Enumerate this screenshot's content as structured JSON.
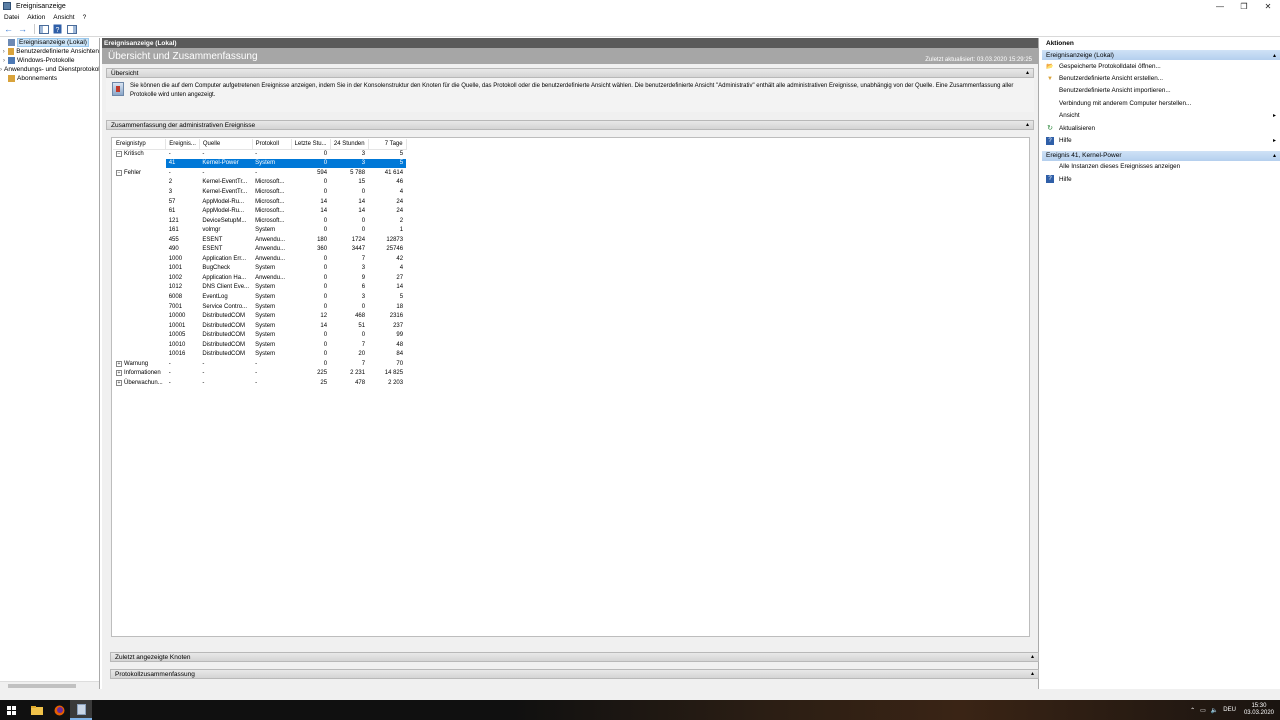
{
  "window": {
    "title": "Ereignisanzeige",
    "controls": [
      "—",
      "❐",
      "✕"
    ]
  },
  "menu": [
    "Datei",
    "Aktion",
    "Ansicht",
    "?"
  ],
  "tree": {
    "items": [
      {
        "label": "Ereignisanzeige (Lokal)",
        "expander": "",
        "selected": true,
        "color": "#6c89b3"
      },
      {
        "label": "Benutzerdefinierte Ansichten",
        "expander": "›",
        "color": "#d9a33b"
      },
      {
        "label": "Windows-Protokolle",
        "expander": "›",
        "color": "#4c79b5"
      },
      {
        "label": "Anwendungs- und Dienstprotokolle",
        "expander": "›",
        "color": "#d9a33b"
      },
      {
        "label": "Abonnements",
        "expander": "",
        "color": "#d9a33b"
      }
    ]
  },
  "center": {
    "header": "Ereignisanzeige (Lokal)",
    "title": "Übersicht und Zusammenfassung",
    "updated": "Zuletzt aktualisiert: 03.03.2020 15:29:25",
    "overview_label": "Übersicht",
    "overview_text": "Sie können die auf dem Computer aufgetretenen Ereignisse anzeigen, indem Sie in der Konsolenstruktur den Knoten für die Quelle, das Protokoll oder die benutzerdefinierte Ansicht wählen. Die benutzerdefinierte Ansicht \"Administrativ\" enthält alle administrativen Ereignisse, unabhängig von der Quelle. Eine Zusammenfassung aller Protokolle wird unten angezeigt.",
    "summary_label": "Zusammenfassung der administrativen Ereignisse",
    "recent_label": "Zuletzt angezeigte Knoten",
    "log_summary_label": "Protokollzusammenfassung",
    "collapse_glyph": "▴"
  },
  "table": {
    "headers": [
      "Ereignistyp",
      "Ereignis...",
      "Quelle",
      "Protokoll",
      "Letzte Stu...",
      "24 Stunden",
      "7 Tage"
    ],
    "rows": [
      {
        "group": true,
        "box": "−",
        "type": "Kritisch",
        "id": "-",
        "source": "-",
        "log": "-",
        "h": "0",
        "d": "3",
        "w": "5"
      },
      {
        "group": false,
        "selected": true,
        "type": "",
        "id": "41",
        "source": "Kernel-Power",
        "log": "System",
        "h": "0",
        "d": "3",
        "w": "5"
      },
      {
        "group": true,
        "box": "−",
        "type": "Fehler",
        "id": "-",
        "source": "-",
        "log": "-",
        "h": "594",
        "d": "5 788",
        "w": "41 614"
      },
      {
        "type": "",
        "id": "2",
        "source": "Kernel-EventTr...",
        "log": "Microsoft...",
        "h": "0",
        "d": "15",
        "w": "46"
      },
      {
        "type": "",
        "id": "3",
        "source": "Kernel-EventTr...",
        "log": "Microsoft...",
        "h": "0",
        "d": "0",
        "w": "4"
      },
      {
        "type": "",
        "id": "57",
        "source": "AppModel-Ru...",
        "log": "Microsoft...",
        "h": "14",
        "d": "14",
        "w": "24"
      },
      {
        "type": "",
        "id": "61",
        "source": "AppModel-Ru...",
        "log": "Microsoft...",
        "h": "14",
        "d": "14",
        "w": "24"
      },
      {
        "type": "",
        "id": "121",
        "source": "DeviceSetupM...",
        "log": "Microsoft...",
        "h": "0",
        "d": "0",
        "w": "2"
      },
      {
        "type": "",
        "id": "161",
        "source": "volmgr",
        "log": "System",
        "h": "0",
        "d": "0",
        "w": "1"
      },
      {
        "type": "",
        "id": "455",
        "source": "ESENT",
        "log": "Anwendu...",
        "h": "180",
        "d": "1724",
        "w": "12873"
      },
      {
        "type": "",
        "id": "490",
        "source": "ESENT",
        "log": "Anwendu...",
        "h": "360",
        "d": "3447",
        "w": "25746"
      },
      {
        "type": "",
        "id": "1000",
        "source": "Application Err...",
        "log": "Anwendu...",
        "h": "0",
        "d": "7",
        "w": "42"
      },
      {
        "type": "",
        "id": "1001",
        "source": "BugCheck",
        "log": "System",
        "h": "0",
        "d": "3",
        "w": "4"
      },
      {
        "type": "",
        "id": "1002",
        "source": "Application Ha...",
        "log": "Anwendu...",
        "h": "0",
        "d": "9",
        "w": "27"
      },
      {
        "type": "",
        "id": "1012",
        "source": "DNS Client Eve...",
        "log": "System",
        "h": "0",
        "d": "6",
        "w": "14"
      },
      {
        "type": "",
        "id": "6008",
        "source": "EventLog",
        "log": "System",
        "h": "0",
        "d": "3",
        "w": "5"
      },
      {
        "type": "",
        "id": "7001",
        "source": "Service Contro...",
        "log": "System",
        "h": "0",
        "d": "0",
        "w": "18"
      },
      {
        "type": "",
        "id": "10000",
        "source": "DistributedCOM",
        "log": "System",
        "h": "12",
        "d": "468",
        "w": "2316"
      },
      {
        "type": "",
        "id": "10001",
        "source": "DistributedCOM",
        "log": "System",
        "h": "14",
        "d": "51",
        "w": "237"
      },
      {
        "type": "",
        "id": "10005",
        "source": "DistributedCOM",
        "log": "System",
        "h": "0",
        "d": "0",
        "w": "99"
      },
      {
        "type": "",
        "id": "10010",
        "source": "DistributedCOM",
        "log": "System",
        "h": "0",
        "d": "7",
        "w": "48"
      },
      {
        "type": "",
        "id": "10016",
        "source": "DistributedCOM",
        "log": "System",
        "h": "0",
        "d": "20",
        "w": "84"
      },
      {
        "group": true,
        "box": "+",
        "type": "Warnung",
        "id": "-",
        "source": "-",
        "log": "-",
        "h": "0",
        "d": "7",
        "w": "70"
      },
      {
        "group": true,
        "box": "+",
        "type": "Informationen",
        "id": "-",
        "source": "-",
        "log": "-",
        "h": "225",
        "d": "2 231",
        "w": "14 825"
      },
      {
        "group": true,
        "box": "+",
        "type": "Überwachun...",
        "id": "-",
        "source": "-",
        "log": "-",
        "h": "25",
        "d": "478",
        "w": "2 203"
      }
    ]
  },
  "actions": {
    "title": "Aktionen",
    "section1": "Ereignisanzeige (Lokal)",
    "items1": [
      {
        "label": "Gespeicherte Protokolldatei öffnen...",
        "icon": "open-folder-icon",
        "glyph": "📂",
        "arrow": ""
      },
      {
        "label": "Benutzerdefinierte Ansicht erstellen...",
        "icon": "filter-icon",
        "glyph": "▼",
        "arrow": ""
      },
      {
        "label": "Benutzerdefinierte Ansicht importieren...",
        "icon": "",
        "glyph": "",
        "arrow": ""
      },
      {
        "label": "Verbindung mit anderem Computer herstellen...",
        "icon": "",
        "glyph": "",
        "arrow": ""
      },
      {
        "label": "Ansicht",
        "icon": "",
        "glyph": "",
        "arrow": "▸"
      },
      {
        "label": "Aktualisieren",
        "icon": "refresh-icon",
        "glyph": "↻",
        "arrow": ""
      },
      {
        "label": "Hilfe",
        "icon": "help-icon",
        "glyph": "?",
        "arrow": "▸"
      }
    ],
    "section2": "Ereignis 41, Kernel-Power",
    "items2": [
      {
        "label": "Alle Instanzen dieses Ereignisses anzeigen",
        "icon": "",
        "glyph": "",
        "arrow": ""
      },
      {
        "label": "Hilfe",
        "icon": "help-icon",
        "glyph": "?",
        "arrow": ""
      }
    ],
    "collapse_glyph": "▴"
  },
  "taskbar": {
    "lang": "DEU",
    "time": "15:30",
    "date": "03.03.2020"
  },
  "colors": {
    "accent": "#0078d7",
    "header_dark": "#5a5a5a",
    "title_gray": "#a6a6a6",
    "action_section": "#b4cfee"
  }
}
